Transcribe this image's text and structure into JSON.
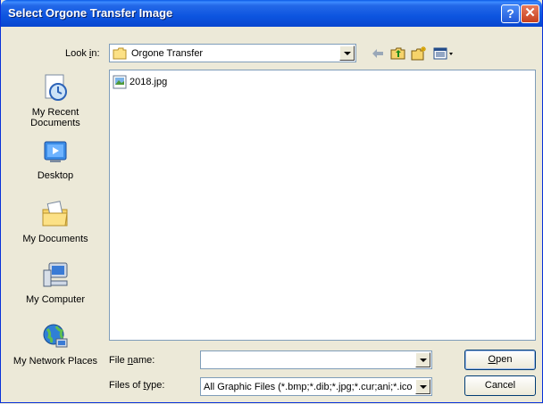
{
  "window": {
    "title": "Select Orgone Transfer Image"
  },
  "titlebar": {
    "help": "?",
    "close": "✕"
  },
  "lookin": {
    "label_pre": "Look ",
    "label_key": "i",
    "label_post": "n:",
    "value": "Orgone Transfer"
  },
  "places": [
    {
      "label": "My Recent Documents",
      "icon": "recent-documents-icon"
    },
    {
      "label": "Desktop",
      "icon": "desktop-icon"
    },
    {
      "label": "My Documents",
      "icon": "my-documents-icon"
    },
    {
      "label": "My Computer",
      "icon": "my-computer-icon"
    },
    {
      "label": "My Network Places",
      "icon": "network-places-icon"
    }
  ],
  "files": [
    {
      "name": "2018.jpg",
      "icon": "jpg-file-icon"
    }
  ],
  "filename": {
    "label_pre": "File ",
    "label_key": "n",
    "label_post": "ame:",
    "value": ""
  },
  "filetype": {
    "label_pre": "Files of ",
    "label_key": "t",
    "label_post": "ype:",
    "value": "All Graphic Files (*.bmp;*.dib;*.jpg;*.cur;ani;*.ico"
  },
  "buttons": {
    "open_key": "O",
    "open_rest": "pen",
    "cancel": "Cancel"
  },
  "colors": {
    "titlebar": "#0a5ae6",
    "face": "#ece9d8",
    "border": "#7f9db9"
  }
}
